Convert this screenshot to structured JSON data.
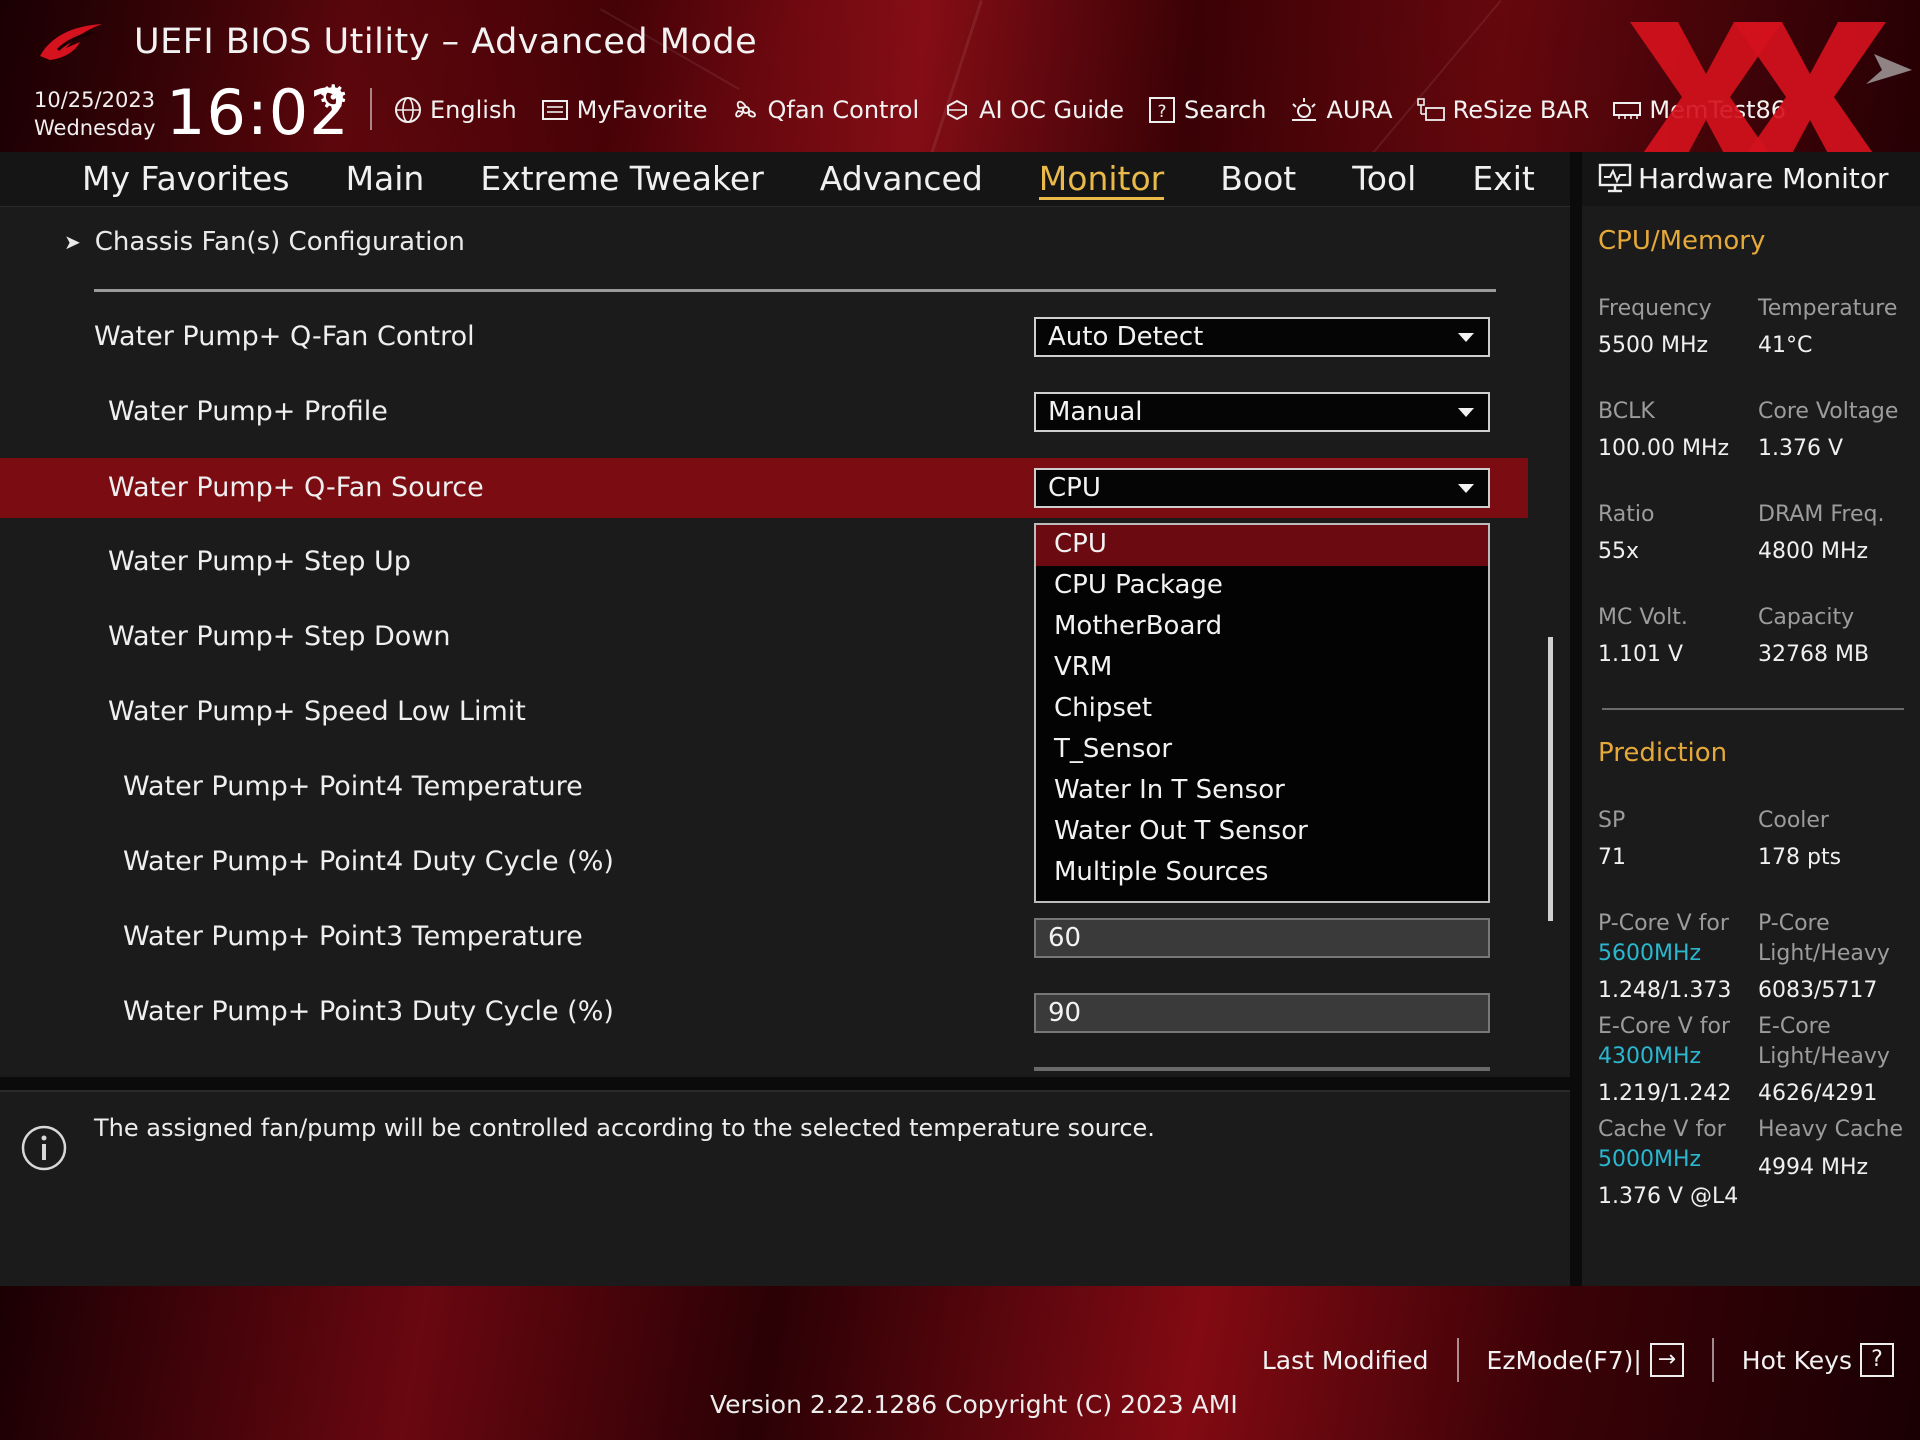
{
  "header": {
    "title": "UEFI BIOS Utility – Advanced Mode",
    "date": "10/25/2023",
    "weekday": "Wednesday",
    "time": "16:02",
    "toolbar": [
      {
        "label": "English",
        "icon": "globe-icon"
      },
      {
        "label": "MyFavorite",
        "icon": "favorite-icon"
      },
      {
        "label": "Qfan Control",
        "icon": "fan-icon"
      },
      {
        "label": "AI OC Guide",
        "icon": "ai-chip-icon"
      },
      {
        "label": "Search",
        "icon": "help-search-icon"
      },
      {
        "label": "AURA",
        "icon": "aura-icon"
      },
      {
        "label": "ReSize BAR",
        "icon": "resize-bar-icon"
      },
      {
        "label": "MemTest86",
        "icon": "memtest-icon"
      }
    ]
  },
  "menu": {
    "tabs": [
      "My Favorites",
      "Main",
      "Extreme Tweaker",
      "Advanced",
      "Monitor",
      "Boot",
      "Tool",
      "Exit"
    ],
    "active": "Monitor"
  },
  "main": {
    "breadcrumb": "Chassis Fan(s) Configuration",
    "rows": [
      {
        "label": "Water Pump+ Q-Fan Control",
        "value": "Auto Detect"
      },
      {
        "label": "Water Pump+ Profile",
        "value": "Manual"
      },
      {
        "label": "Water Pump+ Q-Fan Source",
        "value": "CPU"
      },
      {
        "label": "Water Pump+ Step Up"
      },
      {
        "label": "Water Pump+ Step Down"
      },
      {
        "label": "Water Pump+ Speed Low Limit"
      },
      {
        "label": "Water Pump+ Point4 Temperature"
      },
      {
        "label": "Water Pump+ Point4 Duty Cycle (%)"
      },
      {
        "label": "Water Pump+ Point3 Temperature",
        "value": "60"
      },
      {
        "label": "Water Pump+ Point3 Duty Cycle (%)",
        "value": "90"
      }
    ],
    "dropdown_options": [
      "CPU",
      "CPU Package",
      "MotherBoard",
      "VRM",
      "Chipset",
      "T_Sensor",
      "Water In T Sensor",
      "Water Out T Sensor",
      "Multiple Sources"
    ],
    "dropdown_selected": "CPU"
  },
  "help": {
    "text": "The assigned fan/pump will be controlled according to the selected temperature source."
  },
  "hw_monitor": {
    "title": "Hardware Monitor",
    "cpu_memory": {
      "heading": "CPU/Memory",
      "frequency_label": "Frequency",
      "frequency": "5500 MHz",
      "temperature_label": "Temperature",
      "temperature": "41°C",
      "bclk_label": "BCLK",
      "bclk": "100.00 MHz",
      "core_voltage_label": "Core Voltage",
      "core_voltage": "1.376 V",
      "ratio_label": "Ratio",
      "ratio": "55x",
      "dram_label": "DRAM Freq.",
      "dram": "4800 MHz",
      "mc_volt_label": "MC Volt.",
      "mc_volt": "1.101 V",
      "capacity_label": "Capacity",
      "capacity": "32768 MB"
    },
    "prediction": {
      "heading": "Prediction",
      "sp_label": "SP",
      "sp": "71",
      "cooler_label": "Cooler",
      "cooler": "178 pts",
      "pcore_v_label": "P-Core V for",
      "pcore_v_freq": "5600MHz",
      "pcore_v": "1.248/1.373",
      "pcore_lh_label1": "P-Core",
      "pcore_lh_label2": "Light/Heavy",
      "pcore_lh": "6083/5717",
      "ecore_v_label": "E-Core V for",
      "ecore_v_freq": "4300MHz",
      "ecore_v": "1.219/1.242",
      "ecore_lh_label1": "E-Core",
      "ecore_lh_label2": "Light/Heavy",
      "ecore_lh": "4626/4291",
      "cache_v_label": "Cache V for",
      "cache_v_freq": "5000MHz",
      "cache_v": "1.376 V @L4",
      "heavy_cache_label": "Heavy Cache",
      "heavy_cache": "4994 MHz"
    }
  },
  "footer": {
    "last_modified": "Last Modified",
    "ezmode": "EzMode(F7)|",
    "hot_keys": "Hot Keys",
    "version": "Version 2.22.1286 Copyright (C) 2023 AMI"
  },
  "colors": {
    "accent_gold": "#e9b94a",
    "selection_red": "#7a0c12",
    "cyan": "#2bb7d0",
    "brand_red": "#a0101a"
  }
}
